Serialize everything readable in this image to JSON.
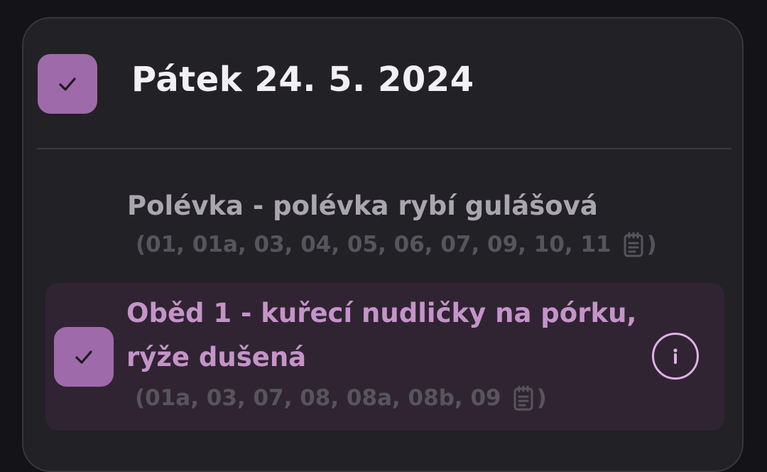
{
  "day": {
    "title": "Pátek 24. 5. 2024",
    "checked": true
  },
  "items": [
    {
      "title": "Polévka - polévka rybí gulášová",
      "allergens_open": "(",
      "allergens": "01, 01a, 03, 04, 05, 06, 07, 09, 10, 11",
      "allergens_close": ")",
      "selected": false
    },
    {
      "title_line1": "Oběd 1 - kuřecí nudličky na pórku,",
      "title_line2": "rýže dušená",
      "allergens_open": "(",
      "allergens": "01a, 03, 07, 08, 08a, 08b, 09",
      "allergens_close": ")",
      "selected": true,
      "info_icon": "info-icon"
    }
  ],
  "icons": {
    "check": "check-icon",
    "note": "note-icon",
    "info": "info-icon"
  },
  "colors": {
    "accent": "#9f6aa9",
    "selected_bg": "#302433",
    "selected_text": "#c494c9",
    "card_bg": "#222125"
  }
}
